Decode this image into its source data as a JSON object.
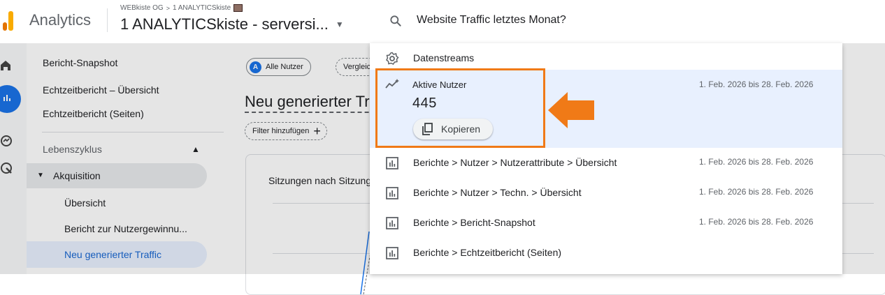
{
  "topbar": {
    "app_name": "Analytics",
    "breadcrumb": {
      "account": "WEBkiste OG",
      "separator": ">",
      "property": "1 ANALYTICSkiste"
    },
    "property_title": "1 ANALYTICSkiste - serversi...",
    "search_query": "Website Traffic letztes Monat?"
  },
  "sidebar": {
    "items": [
      {
        "label": "Bericht-Snapshot"
      },
      {
        "label": "Echtzeitbericht – Übersicht"
      },
      {
        "label": "Echtzeitbericht (Seiten)"
      }
    ],
    "section": {
      "label": "Lebenszyklus"
    },
    "group": {
      "label": "Akquisition"
    },
    "sub_items": [
      {
        "label": "Übersicht"
      },
      {
        "label": "Bericht zur Nutzergewinnu..."
      },
      {
        "label": "Neu generierter Traffic"
      }
    ]
  },
  "main": {
    "segment_chip": {
      "avatar": "A",
      "label": "Alle Nutzer"
    },
    "compare_chip": {
      "label": "Vergleich"
    },
    "page_title": "Neu generierter Traffic",
    "filter_chip": {
      "label": "Filter hinzufügen",
      "icon": "+"
    },
    "card_title": "Sitzungen nach Sitzungsquelle"
  },
  "results": {
    "top_item": {
      "label": "Datenstreams",
      "icon": "settings-icon"
    },
    "highlight": {
      "label": "Aktive Nutzer",
      "value": "445",
      "date": "1. Feb. 2026 bis 28. Feb. 2026",
      "copy_label": "Kopieren",
      "icon": "insights-icon"
    },
    "rows": [
      {
        "label": "Berichte > Nutzer > Nutzerattribute > Übersicht",
        "date": "1. Feb. 2026 bis 28. Feb. 2026"
      },
      {
        "label": "Berichte > Nutzer > Techn. > Übersicht",
        "date": "1. Feb. 2026 bis 28. Feb. 2026"
      },
      {
        "label": "Berichte > Bericht-Snapshot",
        "date": "1. Feb. 2026 bis 28. Feb. 2026"
      },
      {
        "label": "Berichte > Echtzeitbericht (Seiten)",
        "date": ""
      }
    ]
  },
  "colors": {
    "accent": "#1a73e8",
    "highlight_bg": "#e8f0fe",
    "annotation": "#f07a17"
  }
}
